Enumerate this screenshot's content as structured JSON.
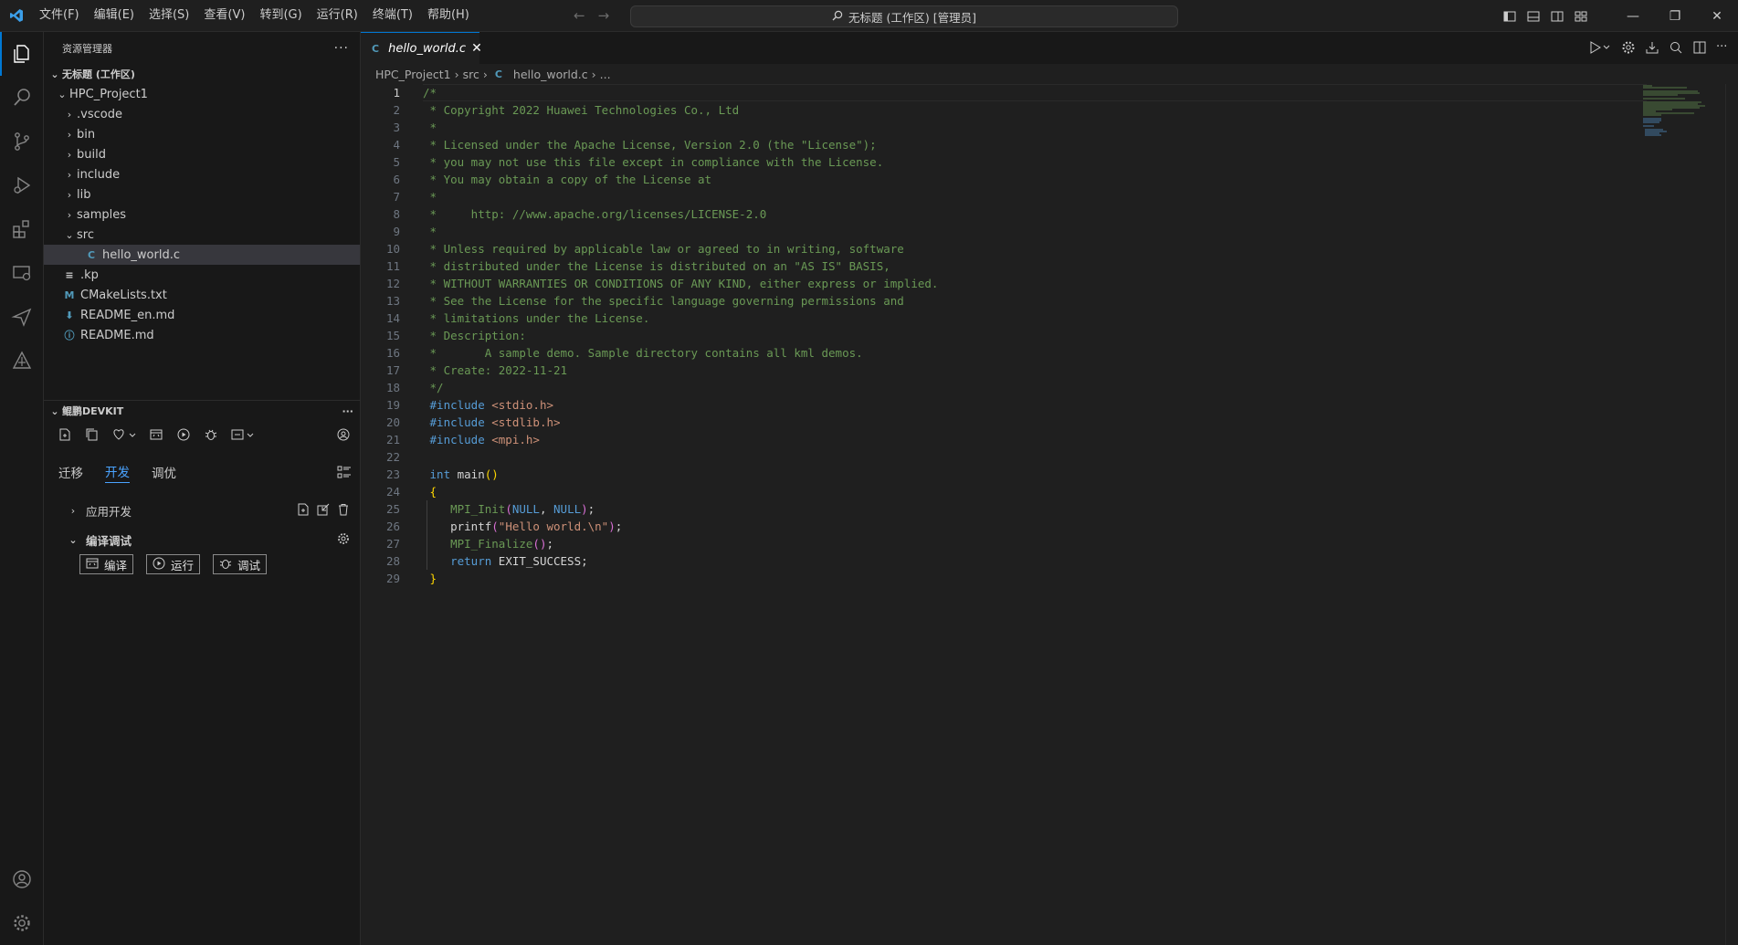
{
  "titlebar": {
    "menu": [
      "文件(F)",
      "编辑(E)",
      "选择(S)",
      "查看(V)",
      "转到(G)",
      "运行(R)",
      "终端(T)",
      "帮助(H)"
    ],
    "search_text": "无标题 (工作区) [管理员]"
  },
  "activity_icons": [
    "explorer-icon",
    "search-icon",
    "source-control-icon",
    "run-debug-icon",
    "extensions-icon",
    "remote-explorer-icon",
    "send-icon",
    "devkit-icon"
  ],
  "sidebar": {
    "title": "资源管理器",
    "workspace": "无标题 (工作区)",
    "project": "HPC_Project1",
    "tree": [
      {
        "label": ".vscode",
        "type": "folder",
        "indent": 1,
        "expanded": false
      },
      {
        "label": "bin",
        "type": "folder",
        "indent": 1,
        "expanded": false
      },
      {
        "label": "build",
        "type": "folder",
        "indent": 1,
        "expanded": false
      },
      {
        "label": "include",
        "type": "folder",
        "indent": 1,
        "expanded": false
      },
      {
        "label": "lib",
        "type": "folder",
        "indent": 1,
        "expanded": false
      },
      {
        "label": "samples",
        "type": "folder",
        "indent": 1,
        "expanded": false
      },
      {
        "label": "src",
        "type": "folder",
        "indent": 1,
        "expanded": true
      },
      {
        "label": "hello_world.c",
        "type": "c",
        "indent": 2,
        "selected": true
      },
      {
        "label": ".kp",
        "type": "kp",
        "indent": 1
      },
      {
        "label": "CMakeLists.txt",
        "type": "cmake",
        "indent": 1
      },
      {
        "label": "README_en.md",
        "type": "md",
        "indent": 1
      },
      {
        "label": "README.md",
        "type": "info",
        "indent": 1
      }
    ],
    "devkit": {
      "title": "鲲鹏DEVKIT",
      "tabs": [
        "迁移",
        "开发",
        "调优"
      ],
      "active_tab": 1,
      "app_dev": "应用开发",
      "compile_debug": "编译调试",
      "buttons": [
        "编译",
        "运行",
        "调试"
      ]
    }
  },
  "editor": {
    "tab_label": "hello_world.c",
    "breadcrumbs": [
      "HPC_Project1",
      "src",
      "hello_world.c",
      "..."
    ],
    "current_line": 1,
    "lines": [
      [
        {
          "t": "/*",
          "c": "comment"
        }
      ],
      [
        {
          "t": " * Copyright 2022 Huawei Technologies Co., Ltd",
          "c": "comment"
        }
      ],
      [
        {
          "t": " *",
          "c": "comment"
        }
      ],
      [
        {
          "t": " * Licensed under the Apache License, Version 2.0 (the \"License\");",
          "c": "comment"
        }
      ],
      [
        {
          "t": " * you may not use this file except in compliance with the License.",
          "c": "comment"
        }
      ],
      [
        {
          "t": " * You may obtain a copy of the License at",
          "c": "comment"
        }
      ],
      [
        {
          "t": " *",
          "c": "comment"
        }
      ],
      [
        {
          "t": " *     http: //www.apache.org/licenses/LICENSE-2.0",
          "c": "comment"
        }
      ],
      [
        {
          "t": " *",
          "c": "comment"
        }
      ],
      [
        {
          "t": " * Unless required by applicable law or agreed to in writing, software",
          "c": "comment"
        }
      ],
      [
        {
          "t": " * distributed under the License is distributed on an \"AS IS\" BASIS,",
          "c": "comment"
        }
      ],
      [
        {
          "t": " * WITHOUT WARRANTIES OR CONDITIONS OF ANY KIND, either express or implied.",
          "c": "comment"
        }
      ],
      [
        {
          "t": " * See the License for the specific language governing permissions and",
          "c": "comment"
        }
      ],
      [
        {
          "t": " * limitations under the License.",
          "c": "comment"
        }
      ],
      [
        {
          "t": " * Description:",
          "c": "comment"
        }
      ],
      [
        {
          "t": " *       A sample demo. Sample directory contains all kml demos.",
          "c": "comment"
        }
      ],
      [
        {
          "t": " * Create: 2022-11-21",
          "c": "comment"
        }
      ],
      [
        {
          "t": " */",
          "c": "comment"
        }
      ],
      [
        {
          "t": " #include",
          "c": "keyword"
        },
        {
          "t": " <stdio.h>",
          "c": "string"
        }
      ],
      [
        {
          "t": " #include",
          "c": "keyword"
        },
        {
          "t": " <stdlib.h>",
          "c": "string"
        }
      ],
      [
        {
          "t": " #include",
          "c": "keyword"
        },
        {
          "t": " <mpi.h>",
          "c": "string"
        }
      ],
      [
        {
          "t": "",
          "c": "plain"
        }
      ],
      [
        {
          "t": " int",
          "c": "keyword"
        },
        {
          "t": " main",
          "c": "plain"
        },
        {
          "t": "()",
          "c": "bracket"
        }
      ],
      [
        {
          "t": " {",
          "c": "bracket"
        }
      ],
      [
        {
          "t": "    MPI_Init",
          "c": "macro"
        },
        {
          "t": "(",
          "c": "bracket2"
        },
        {
          "t": "NULL",
          "c": "const"
        },
        {
          "t": ", ",
          "c": "plain"
        },
        {
          "t": "NULL",
          "c": "const"
        },
        {
          "t": ")",
          "c": "bracket2"
        },
        {
          "t": ";",
          "c": "plain"
        }
      ],
      [
        {
          "t": "    printf",
          "c": "plain"
        },
        {
          "t": "(",
          "c": "bracket2"
        },
        {
          "t": "\"Hello world.\\n\"",
          "c": "string"
        },
        {
          "t": ")",
          "c": "bracket2"
        },
        {
          "t": ";",
          "c": "plain"
        }
      ],
      [
        {
          "t": "    MPI_Finalize",
          "c": "macro"
        },
        {
          "t": "()",
          "c": "bracket2"
        },
        {
          "t": ";",
          "c": "plain"
        }
      ],
      [
        {
          "t": "    return",
          "c": "keyword"
        },
        {
          "t": " EXIT_SUCCESS;",
          "c": "plain"
        }
      ],
      [
        {
          "t": " }",
          "c": "bracket"
        }
      ]
    ]
  },
  "colors": {
    "comment": "#6a9955",
    "keyword": "#569cd6",
    "string": "#ce9178",
    "plain": "#d4d4d4",
    "bracket": "#ffd700",
    "bracket2": "#da70d6",
    "macro": "#6a9955",
    "const": "#569cd6",
    "accent": "#0078d4"
  }
}
